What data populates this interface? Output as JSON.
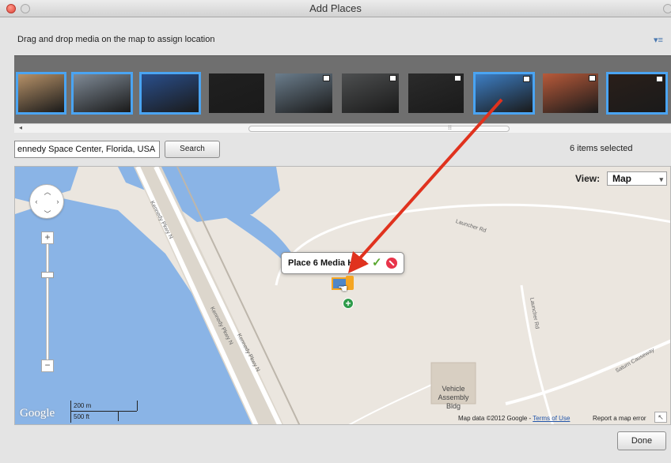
{
  "window": {
    "title": "Add Places"
  },
  "instruction": "Drag and drop media on the map to assign location",
  "filmstrip": {
    "thumbnails": [
      {
        "label": "launch-photo-1",
        "selected": true,
        "video": false,
        "color": "#b69168"
      },
      {
        "label": "launch-pad-photo",
        "selected": true,
        "video": false,
        "color": "#7f8a96"
      },
      {
        "label": "shuttle-night-photo",
        "selected": true,
        "video": false,
        "color": "#2a4f8c"
      },
      {
        "label": "shuttle-landing-photo",
        "selected": false,
        "video": false,
        "color": "#202020"
      },
      {
        "label": "shuttle-runway-video",
        "selected": false,
        "video": true,
        "color": "#6b7d8c"
      },
      {
        "label": "space-station-video",
        "selected": false,
        "video": true,
        "color": "#4d4f50"
      },
      {
        "label": "orbit-video",
        "selected": false,
        "video": true,
        "color": "#2b2b2b"
      },
      {
        "label": "shuttle-sky-video",
        "selected": true,
        "video": true,
        "color": "#3d7ec4"
      },
      {
        "label": "tank-closeup-video",
        "selected": false,
        "video": true,
        "color": "#b85a3a"
      },
      {
        "label": "launch-flame-video",
        "selected": true,
        "video": true,
        "color": "#2a1f1a"
      }
    ]
  },
  "search": {
    "value": "ennedy Space Center, Florida, USA",
    "button_label": "Search"
  },
  "status": {
    "items_selected": "6 items selected"
  },
  "map": {
    "view_label": "View:",
    "view_value": "Map",
    "place_popup": "Place 6 Media Here",
    "roads": {
      "kennedy_pkwy_1": "Kennedy Pkwy N",
      "kennedy_pkwy_2": "Kennedy Pkwy N",
      "kennedy_pkwy_3": "Kennedy Pkwy N",
      "launcher_1": "Launcher Rd",
      "launcher_2": "Launcher Rd",
      "saturn": "Saturn Causeway"
    },
    "building": "Vehicle Assembly Bldg",
    "logo": "Google",
    "scale_metric": "200 m",
    "scale_imperial": "500 ft",
    "attribution_prefix": "Map data ©2012 Google - ",
    "terms": "Terms of Use",
    "report": "Report a map error",
    "colors": {
      "water": "#8ab4e6",
      "land": "#ebe6df",
      "road": "#ffffff",
      "accent": "#e0321e"
    }
  },
  "footer": {
    "done_label": "Done"
  }
}
